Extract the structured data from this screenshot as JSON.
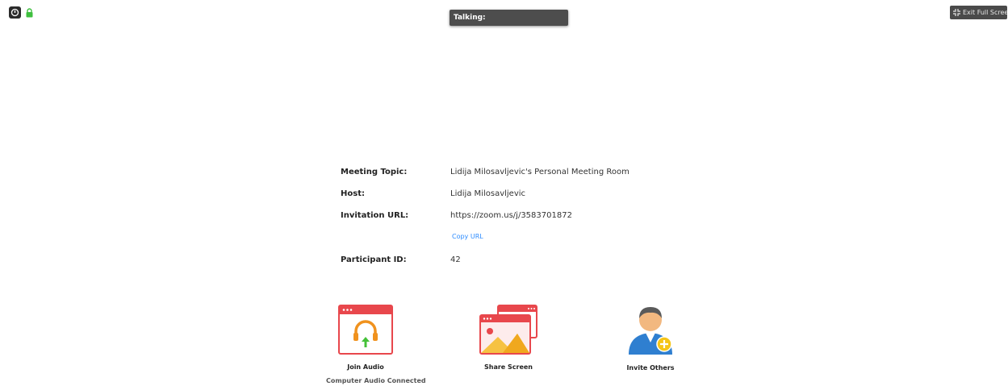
{
  "talking_label": "Talking:",
  "exit_fullscreen_label": "Exit Full Screen",
  "meeting": {
    "topic_label": "Meeting Topic:",
    "topic_value": "Lidija Milosavljevic's Personal Meeting Room",
    "host_label": "Host:",
    "host_value": "Lidija Milosavljevic",
    "url_label": "Invitation URL:",
    "url_value": "https://zoom.us/j/3583701872",
    "copy_url_label": "Copy URL",
    "participant_label": "Participant ID:",
    "participant_value": "42"
  },
  "actions": {
    "join_audio_label": "Join Audio",
    "join_audio_status": "Computer Audio Connected",
    "share_screen_label": "Share Screen",
    "invite_others_label": "Invite Others"
  },
  "colors": {
    "accent_red": "#e8474c",
    "headset_orange": "#f0921e",
    "arrow_green": "#44c138",
    "link_blue": "#2d8cff",
    "lock_green": "#3fbf3f"
  }
}
